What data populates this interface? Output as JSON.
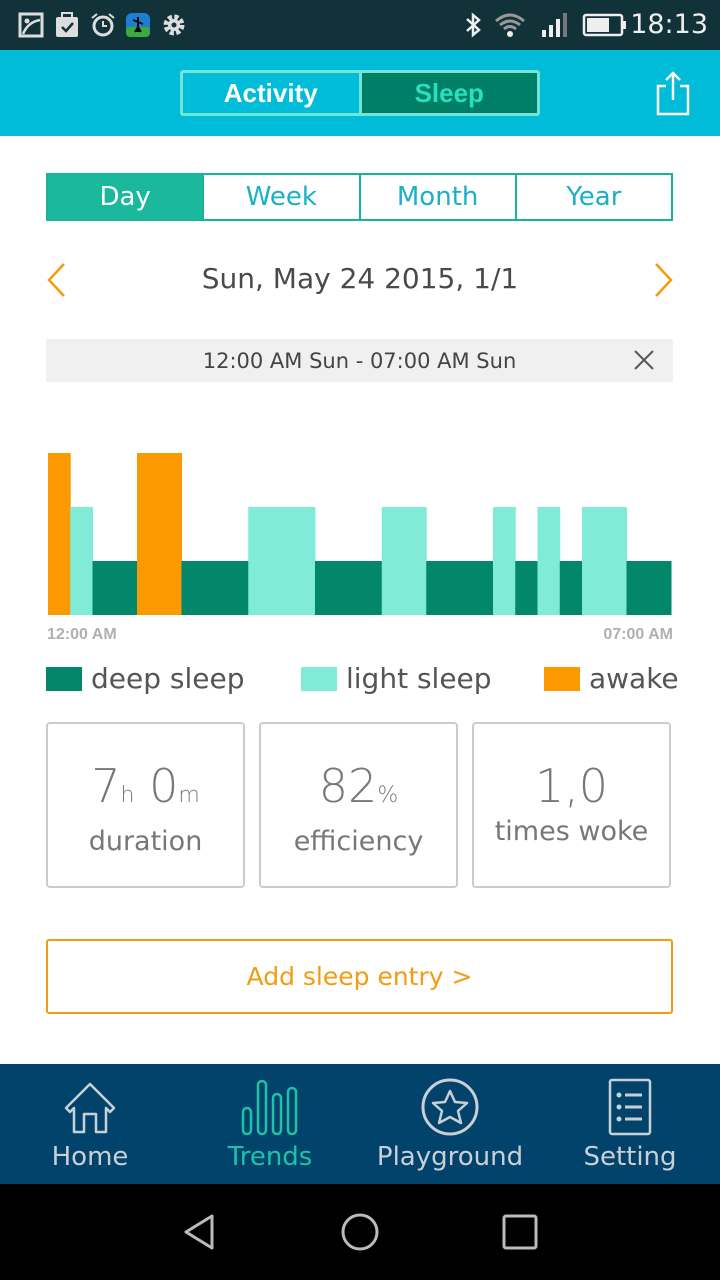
{
  "status_bar": {
    "time": "18:13",
    "icons": [
      "photo-icon",
      "clipboard-check-icon",
      "alarm-icon",
      "app-runner-icon",
      "gear-icon",
      "bluetooth-icon",
      "wifi-icon",
      "signal-icon",
      "battery-icon"
    ]
  },
  "header": {
    "toggle": [
      "Activity",
      "Sleep"
    ],
    "active": "Sleep",
    "share_icon": "share-icon"
  },
  "period_tabs": {
    "items": [
      "Day",
      "Week",
      "Month",
      "Year"
    ],
    "active": "Day"
  },
  "date": {
    "label": "Sun, May 24 2015, 1/1"
  },
  "range": {
    "label": "12:00 AM Sun - 07:00 AM Sun"
  },
  "chart_data": {
    "type": "bar",
    "x_start_label": "12:00 AM",
    "x_end_label": "07:00 AM",
    "stages": {
      "deep": "deep sleep",
      "light": "light sleep",
      "awake": "awake"
    },
    "colors": {
      "deep": "#02876a",
      "light": "#80ecd8",
      "awake": "#fb9a00"
    },
    "segments": [
      {
        "stage": "awake",
        "minutes": 15
      },
      {
        "stage": "light",
        "minutes": 15
      },
      {
        "stage": "deep",
        "minutes": 30
      },
      {
        "stage": "awake",
        "minutes": 30
      },
      {
        "stage": "deep",
        "minutes": 45
      },
      {
        "stage": "light",
        "minutes": 45
      },
      {
        "stage": "deep",
        "minutes": 45
      },
      {
        "stage": "light",
        "minutes": 30
      },
      {
        "stage": "deep",
        "minutes": 45
      },
      {
        "stage": "light",
        "minutes": 15
      },
      {
        "stage": "deep",
        "minutes": 15
      },
      {
        "stage": "light",
        "minutes": 15
      },
      {
        "stage": "deep",
        "minutes": 15
      },
      {
        "stage": "light",
        "minutes": 30
      },
      {
        "stage": "deep",
        "minutes": 30
      }
    ]
  },
  "legend": {
    "deep": "deep sleep",
    "light": "light sleep",
    "awake": "awake"
  },
  "stats": {
    "duration": {
      "h": "7",
      "h_unit": "h",
      "m": "0",
      "m_unit": "m",
      "label": "duration"
    },
    "efficiency": {
      "value": "82",
      "unit": "%",
      "label": "efficiency"
    },
    "woke": {
      "value": "1,0",
      "label": "times woke"
    }
  },
  "add_entry": "Add sleep entry  >",
  "nav": {
    "items": [
      "Home",
      "Trends",
      "Playground",
      "Setting"
    ],
    "active": "Trends"
  }
}
